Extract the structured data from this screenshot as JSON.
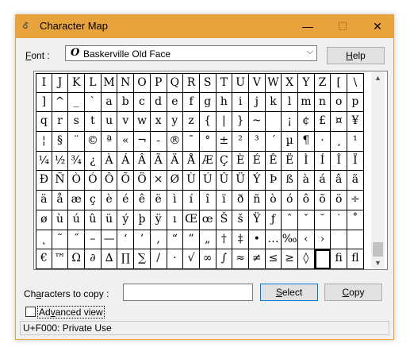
{
  "window": {
    "title": "Character Map",
    "icon": "charmap-icon",
    "controls": {
      "minimize": "—",
      "maximize": "☐",
      "close": "✕"
    }
  },
  "font": {
    "label_prefix": "F",
    "label_rest": "ont :",
    "selected": "Baskerville Old Face",
    "glyph": "O"
  },
  "help_button": {
    "prefix": "H",
    "rest": "elp"
  },
  "grid": {
    "rows": [
      [
        "I",
        "J",
        "K",
        "L",
        "M",
        "N",
        "O",
        "P",
        "Q",
        "R",
        "S",
        "T",
        "U",
        "V",
        "W",
        "X",
        "Y",
        "Z",
        "[",
        "\\"
      ],
      [
        "]",
        "^",
        "_",
        "`",
        "a",
        "b",
        "c",
        "d",
        "e",
        "f",
        "g",
        "h",
        "i",
        "j",
        "k",
        "l",
        "m",
        "n",
        "o",
        "p"
      ],
      [
        "q",
        "r",
        "s",
        "t",
        "u",
        "v",
        "w",
        "x",
        "y",
        "z",
        "{",
        "|",
        "}",
        "~",
        "",
        "¡",
        "¢",
        "£",
        "¤",
        "¥"
      ],
      [
        "¦",
        "§",
        "¨",
        "©",
        "ª",
        "«",
        "¬",
        "-",
        "®",
        "¯",
        "°",
        "±",
        "²",
        "³",
        "´",
        "µ",
        "¶",
        "·",
        "¸",
        "¹"
      ],
      [
        "¼",
        "½",
        "¾",
        "¿",
        "À",
        "Á",
        "Â",
        "Ã",
        "Ä",
        "Å",
        "Æ",
        "Ç",
        "È",
        "É",
        "Ê",
        "Ë",
        "Ì",
        "Í",
        "Î",
        "Ï"
      ],
      [
        "Ð",
        "Ñ",
        "Ò",
        "Ó",
        "Ô",
        "Õ",
        "Ö",
        "×",
        "Ø",
        "Ù",
        "Ú",
        "Û",
        "Ü",
        "Ý",
        "Þ",
        "ß",
        "à",
        "á",
        "â",
        "ã"
      ],
      [
        "ä",
        "å",
        "æ",
        "ç",
        "è",
        "é",
        "ê",
        "ë",
        "ì",
        "í",
        "î",
        "ï",
        "ð",
        "ñ",
        "ò",
        "ó",
        "ô",
        "õ",
        "ö",
        "÷"
      ],
      [
        "ø",
        "ù",
        "ú",
        "û",
        "ü",
        "ý",
        "þ",
        "ÿ",
        "ı",
        "Œ",
        "œ",
        "Š",
        "š",
        "Ÿ",
        "ƒ",
        "ˆ",
        "ˇ",
        "˘",
        "˙",
        "˚"
      ],
      [
        "˛",
        "˜",
        "˝",
        "–",
        "—",
        "‘",
        "’",
        "‚",
        "“",
        "”",
        "„",
        "†",
        "‡",
        "•",
        "…",
        "‰",
        "‹",
        "›",
        "",
        ""
      ],
      [
        "€",
        "™",
        "Ω",
        "∂",
        "∆",
        "∏",
        "∑",
        "/",
        "·",
        "√",
        "∞",
        "∫",
        "≈",
        "≠",
        "≤",
        "≥",
        "◊",
        "",
        "ﬁ",
        "ﬂ"
      ]
    ],
    "selected": {
      "row": 9,
      "col": 17
    }
  },
  "copy": {
    "label_prefix": "Ch",
    "label_u": "a",
    "label_rest": "racters to copy :",
    "value": ""
  },
  "select_button": {
    "prefix": "S",
    "rest": "elect"
  },
  "copy_button": {
    "prefix": "C",
    "rest": "opy"
  },
  "advanced": {
    "prefix": "Ad",
    "u": "v",
    "rest": "anced view",
    "checked": false
  },
  "status": "U+F000: Private Use"
}
